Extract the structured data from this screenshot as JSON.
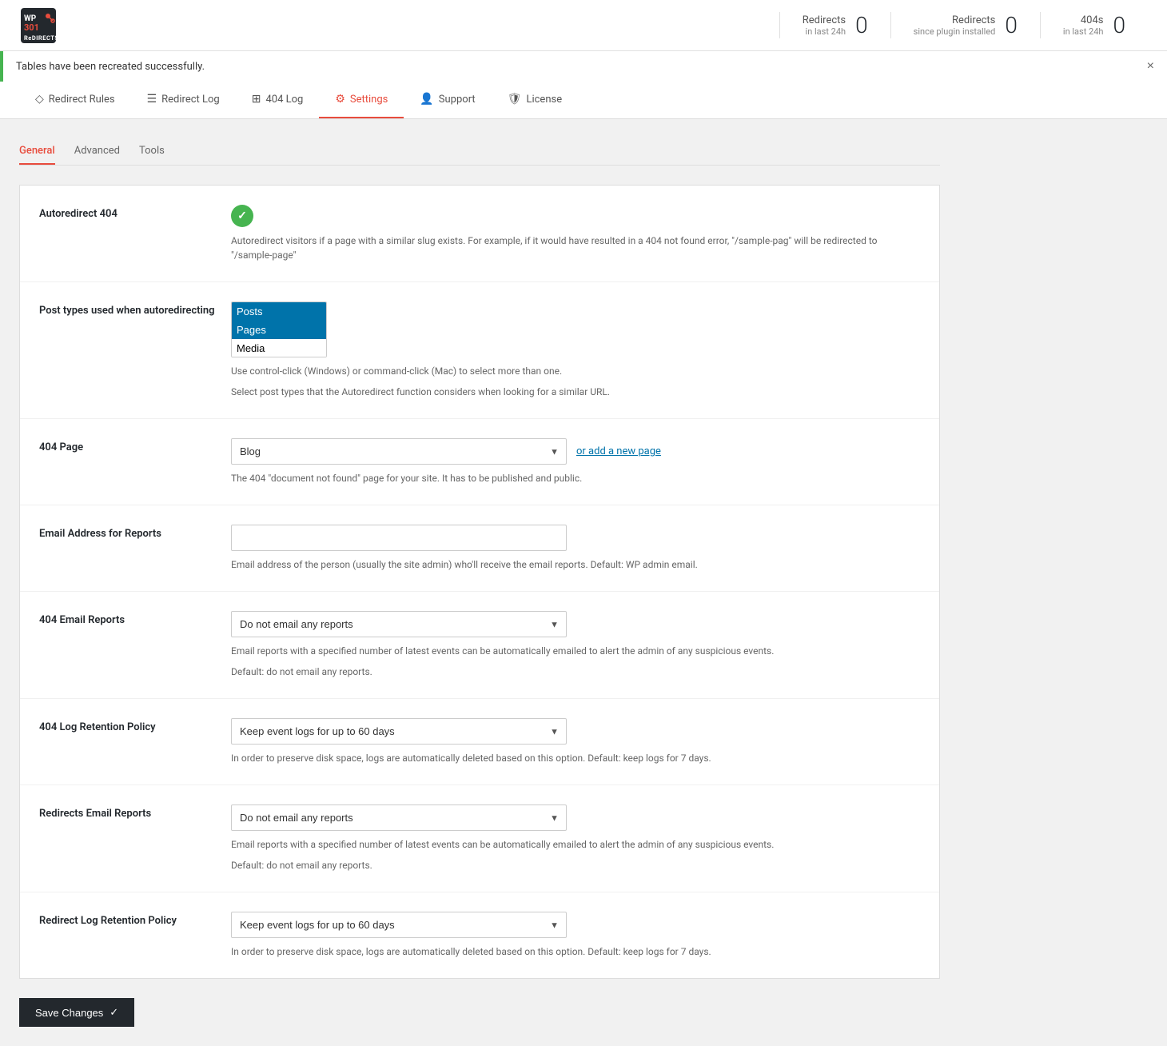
{
  "header": {
    "logo_line1": "WP",
    "logo_line2": "301",
    "logo_line3": "ReDIRECTS",
    "stats": [
      {
        "label": "Redirects",
        "sublabel": "in last 24h",
        "value": "0"
      },
      {
        "label": "Redirects",
        "sublabel": "since plugin installed",
        "value": "0"
      },
      {
        "label": "404s",
        "sublabel": "in last 24h",
        "value": "0"
      }
    ]
  },
  "notice": {
    "text": "Tables have been recreated successfully.",
    "close_label": "×"
  },
  "nav_tabs": [
    {
      "id": "redirect-rules",
      "label": "Redirect Rules",
      "icon": "◇",
      "active": false
    },
    {
      "id": "redirect-log",
      "label": "Redirect Log",
      "icon": "☰",
      "active": false
    },
    {
      "id": "404-log",
      "label": "404 Log",
      "icon": "⊞",
      "active": false
    },
    {
      "id": "settings",
      "label": "Settings",
      "icon": "⚙",
      "active": true
    },
    {
      "id": "support",
      "label": "Support",
      "icon": "👤",
      "active": false
    },
    {
      "id": "license",
      "label": "License",
      "icon": "🛡",
      "active": false
    }
  ],
  "sub_tabs": [
    {
      "id": "general",
      "label": "General",
      "active": true
    },
    {
      "id": "advanced",
      "label": "Advanced",
      "active": false
    },
    {
      "id": "tools",
      "label": "Tools",
      "active": false
    }
  ],
  "settings": {
    "autoredirect_label": "Autoredirect 404",
    "autoredirect_desc": "Autoredirect visitors if a page with a similar slug exists. For example, if it would have resulted in a 404 not found error, \"/sample-pag\" will be redirected to \"/sample-page\"",
    "post_types_label": "Post types used when autoredirecting",
    "post_types_options": [
      "Posts",
      "Pages",
      "Media"
    ],
    "post_types_selected": [
      "Posts",
      "Pages"
    ],
    "post_types_desc1": "Use control-click (Windows) or command-click (Mac) to select more than one.",
    "post_types_desc2": "Select post types that the Autoredirect function considers when looking for a similar URL.",
    "page_404_label": "404 Page",
    "page_404_value": "Blog",
    "page_404_add_link": "or add a new page",
    "page_404_desc": "The 404 \"document not found\" page for your site. It has to be published and public.",
    "email_label": "Email Address for Reports",
    "email_placeholder": "",
    "email_desc": "Email address of the person (usually the site admin) who'll receive the email reports. Default: WP admin email.",
    "email_404_label": "404 Email Reports",
    "email_404_value": "Do not email any reports",
    "email_404_desc1": "Email reports with a specified number of latest events can be automatically emailed to alert the admin of any suspicious events.",
    "email_404_desc2": "Default: do not email any reports.",
    "log_retention_label": "404 Log Retention Policy",
    "log_retention_value": "Keep event logs for up to 60 days",
    "log_retention_desc": "In order to preserve disk space, logs are automatically deleted based on this option. Default: keep logs for 7 days.",
    "redirect_email_label": "Redirects Email Reports",
    "redirect_email_value": "Do not email any reports",
    "redirect_email_desc1": "Email reports with a specified number of latest events can be automatically emailed to alert the admin of any suspicious events.",
    "redirect_email_desc2": "Default: do not email any reports.",
    "redirect_log_label": "Redirect Log Retention Policy",
    "redirect_log_value": "Keep event logs for up to 60 days",
    "redirect_log_desc": "In order to preserve disk space, logs are automatically deleted based on this option. Default: keep logs for 7 days.",
    "save_label": "Save Changes",
    "save_icon": "✓"
  }
}
